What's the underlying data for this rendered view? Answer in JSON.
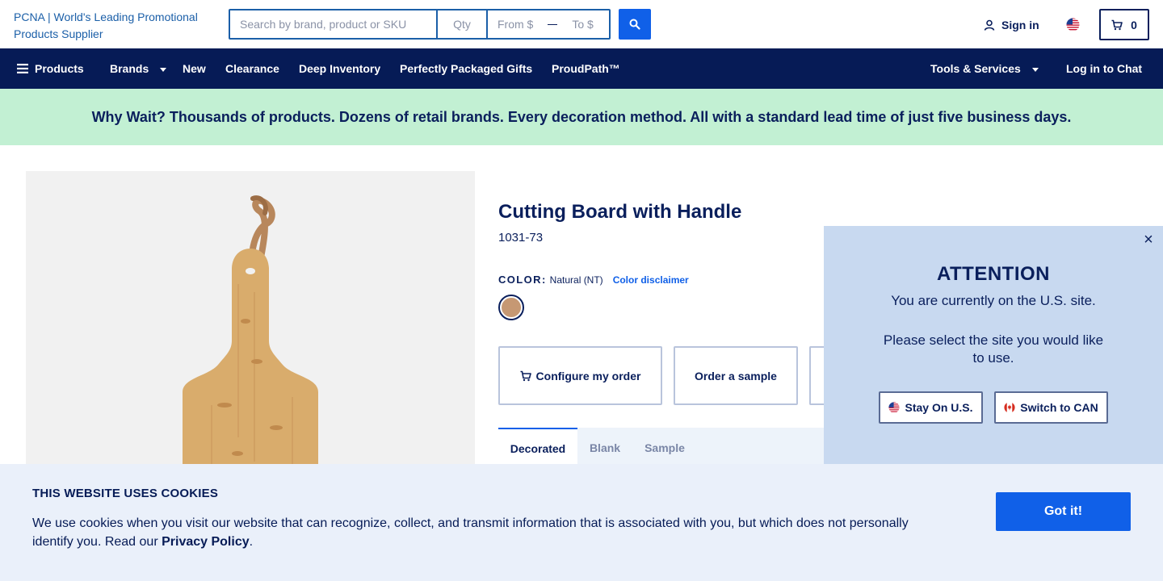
{
  "header": {
    "logo_alt": "PCNA | World's Leading Promotional Products Supplier",
    "search_placeholder": "Search by brand, product or SKU",
    "qty_placeholder": "Qty",
    "from_placeholder": "From $",
    "to_placeholder": "To $",
    "signin_label": "Sign in",
    "cart_count": "0"
  },
  "nav": {
    "items": [
      {
        "label": "Products"
      },
      {
        "label": "Brands"
      },
      {
        "label": "New"
      },
      {
        "label": "Clearance"
      },
      {
        "label": "Deep Inventory"
      },
      {
        "label": "Perfectly Packaged Gifts"
      },
      {
        "label": "ProudPath™"
      }
    ],
    "tools_label": "Tools & Services",
    "chat_label": "Log in to Chat"
  },
  "banner": {
    "text": "Why Wait? Thousands of products. Dozens of retail brands. Every decoration method. All with a standard lead time of just five business days."
  },
  "product": {
    "title": "Cutting Board with Handle",
    "sku": "1031-73",
    "color_label": "COLOR:",
    "color_value": "Natural (NT)",
    "color_disclaimer": "Color disclaimer",
    "swatch_color": "#c69873",
    "actions": {
      "configure": "Configure my order",
      "sample": "Order a sample"
    },
    "tabs": [
      {
        "label": "Decorated"
      },
      {
        "label": "Blank"
      },
      {
        "label": "Sample"
      }
    ]
  },
  "attention": {
    "title": "ATTENTION",
    "line1": "You are currently on the U.S. site.",
    "line2": "Please select the site you would like to use.",
    "stay_label": "Stay On U.S.",
    "switch_label": "Switch to CAN",
    "close_symbol": "×"
  },
  "cookie": {
    "title": "THIS WEBSITE USES COOKIES",
    "text": "We use cookies when you visit our website that can recognize, collect, and transmit information that is associated with you, but which does not personally identify you. Read our ",
    "link": "Privacy Policy",
    "end": ".",
    "button": "Got it!"
  },
  "colors": {
    "navy": "#061b56",
    "accent_blue": "#1060e8",
    "banner_green": "#c2f0d3",
    "popup_bg": "#c8d9f0",
    "cookie_bg": "#eaf0fa"
  }
}
